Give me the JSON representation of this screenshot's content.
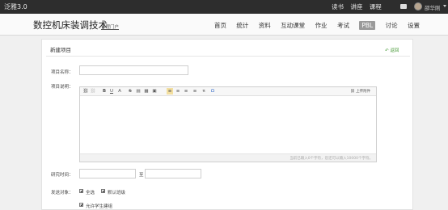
{
  "topbar": {
    "brand": "泛雅3.0",
    "links": [
      "读书",
      "讲座",
      "课程"
    ],
    "username": "邵华刚"
  },
  "header": {
    "course_title": "数控机床装调技术",
    "portal_link": "课程门户",
    "nav": [
      "首页",
      "统计",
      "资料",
      "互动课堂",
      "作业",
      "考试",
      "PBL",
      "讨论",
      "设置"
    ],
    "active_nav": "PBL"
  },
  "panel": {
    "title": "新建项目",
    "back_label": "返回",
    "name_label": "项目名称：",
    "desc_label": "项目说明：",
    "upload_label": "上传附件",
    "word_count": "当前已输入0个字符，您还可以输入10000个字符。",
    "time_label": "研究时间：",
    "time_sep": "至",
    "target_label": "发送对象：",
    "opt_all": "全选",
    "opt_default_class": "默认班级",
    "opt_allow_group": "允许学生建组"
  },
  "icons": [
    "link-icon",
    "unlink-icon",
    "bold-icon",
    "underline-icon",
    "font-color-icon",
    "strikethrough-icon",
    "paste-icon",
    "table-icon",
    "image-icon",
    "align-left-icon",
    "align-center-icon",
    "align-right-icon",
    "align-justify-icon",
    "formula-icon",
    "special-char-icon",
    "attachment-icon",
    "back-icon"
  ]
}
